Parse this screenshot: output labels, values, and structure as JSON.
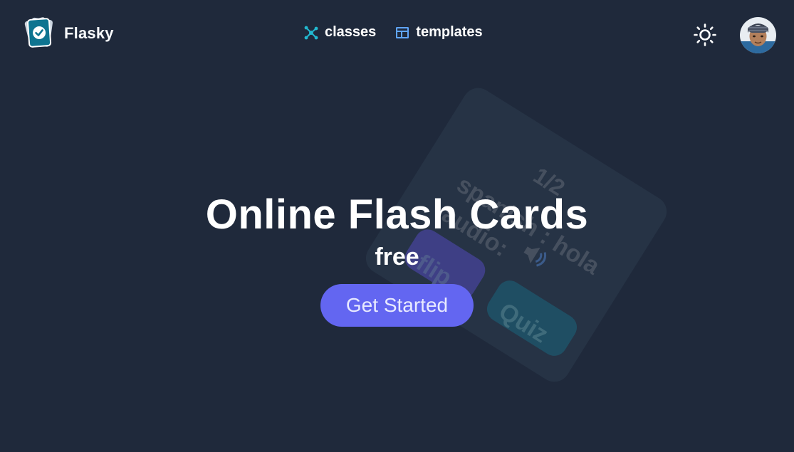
{
  "header": {
    "brand_name": "Flasky",
    "nav": [
      {
        "label": "classes",
        "icon": "molecule-icon"
      },
      {
        "label": "templates",
        "icon": "template-icon"
      }
    ],
    "theme_toggle_icon": "sun-icon",
    "avatar_icon": "user-avatar"
  },
  "hero": {
    "title": "Online Flash Cards",
    "subtitle": "free",
    "cta_label": "Get Started"
  },
  "decoration": {
    "counter": "1/2",
    "line1": "spanish : hola",
    "line2": "audio:",
    "flip_label": "flip",
    "quiz_label": "Quiz"
  },
  "colors": {
    "background": "#1f293b",
    "accent": "#6366f1",
    "logo": "#0e7490",
    "classes_icon": "#22b8cf",
    "templates_icon": "#60a5fa"
  }
}
